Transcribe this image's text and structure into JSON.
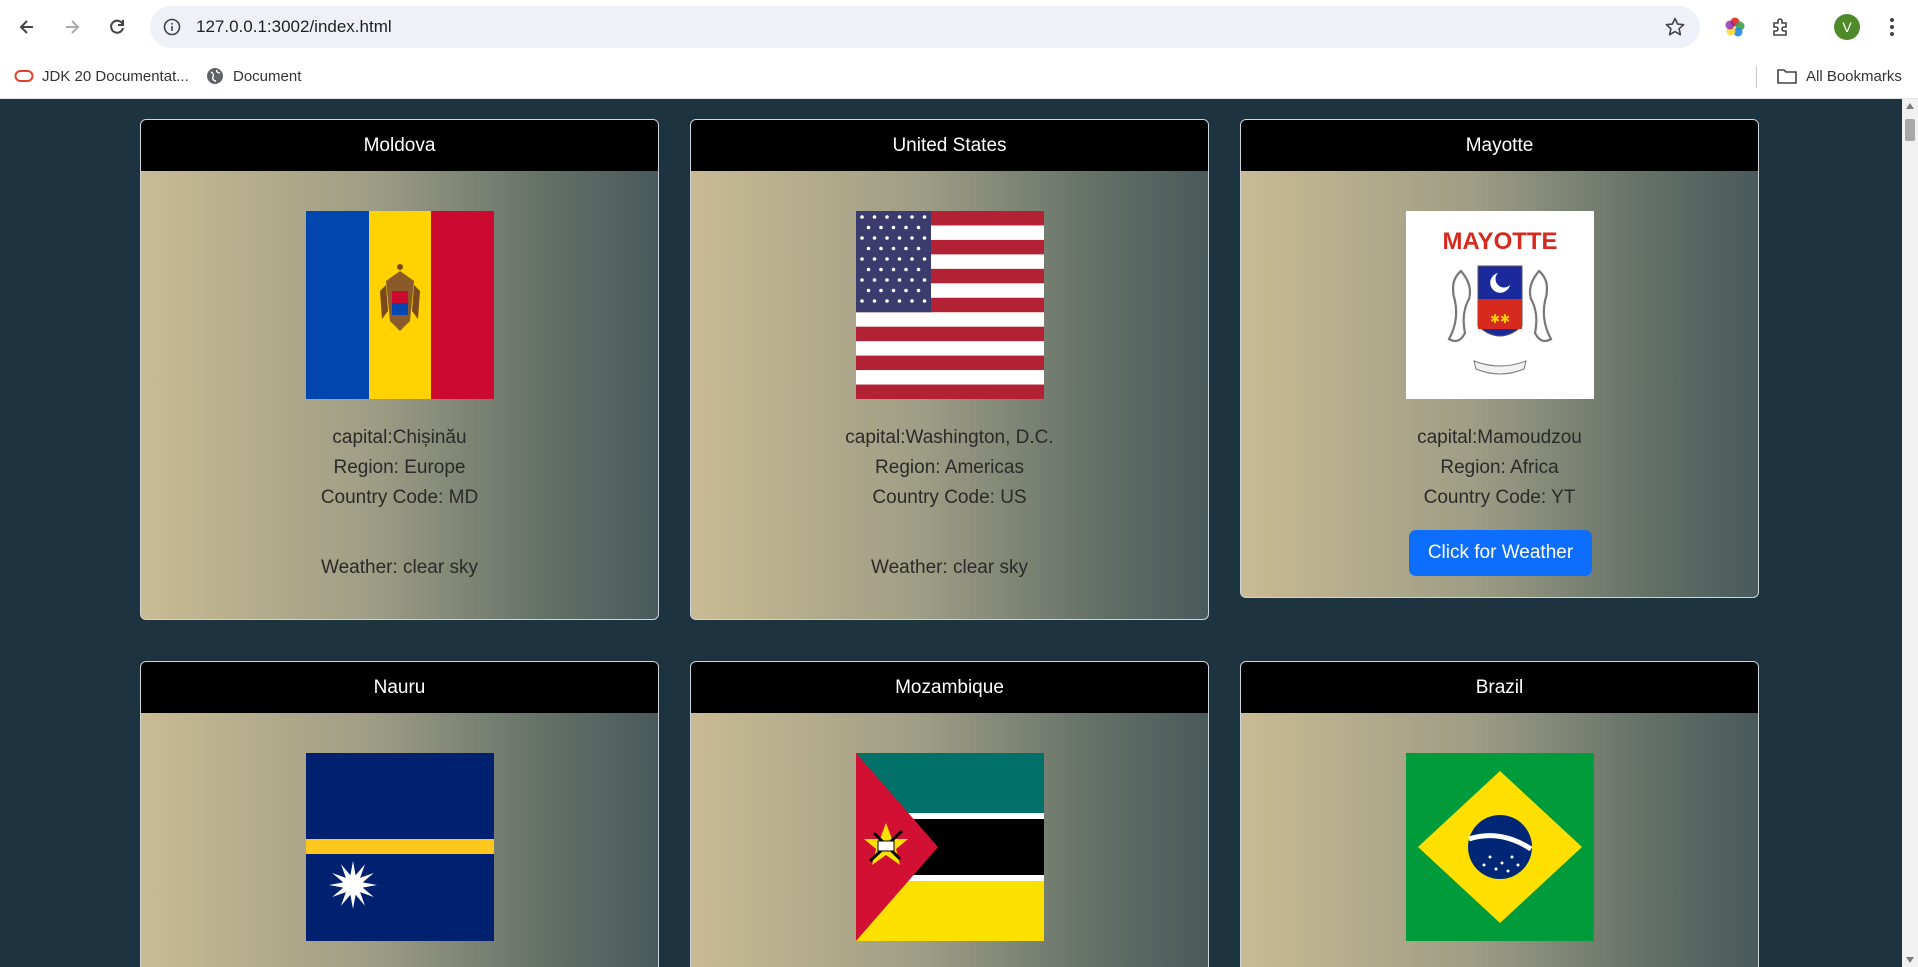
{
  "browser": {
    "url": "127.0.0.1:3002/index.html",
    "avatar_letter": "V",
    "bookmarks": [
      {
        "label": "JDK 20 Documentat...",
        "icon": "oracle-icon"
      },
      {
        "label": "Document",
        "icon": "globe-icon"
      }
    ],
    "all_bookmarks_label": "All Bookmarks"
  },
  "countries": [
    {
      "name": "Moldova",
      "capital": "capital:Chișinău",
      "region": "Region: Europe",
      "code": "Country Code: MD",
      "weather": "Weather: clear sky",
      "flag": "moldova-flag"
    },
    {
      "name": "United States",
      "capital": "capital:Washington, D.C.",
      "region": "Region: Americas",
      "code": "Country Code: US",
      "weather": "Weather: clear sky",
      "flag": "usa-flag"
    },
    {
      "name": "Mayotte",
      "capital": "capital:Mamoudzou",
      "region": "Region: Africa",
      "code": "Country Code: YT",
      "button": "Click for Weather",
      "flag_text": "MAYOTTE",
      "flag": "mayotte-flag"
    },
    {
      "name": "Nauru",
      "flag": "nauru-flag"
    },
    {
      "name": "Mozambique",
      "flag": "mozambique-flag"
    },
    {
      "name": "Brazil",
      "flag": "brazil-flag"
    }
  ],
  "colors": {
    "page_bg": "#1e3340",
    "card_header": "#000000",
    "button": "#0d6efd"
  }
}
